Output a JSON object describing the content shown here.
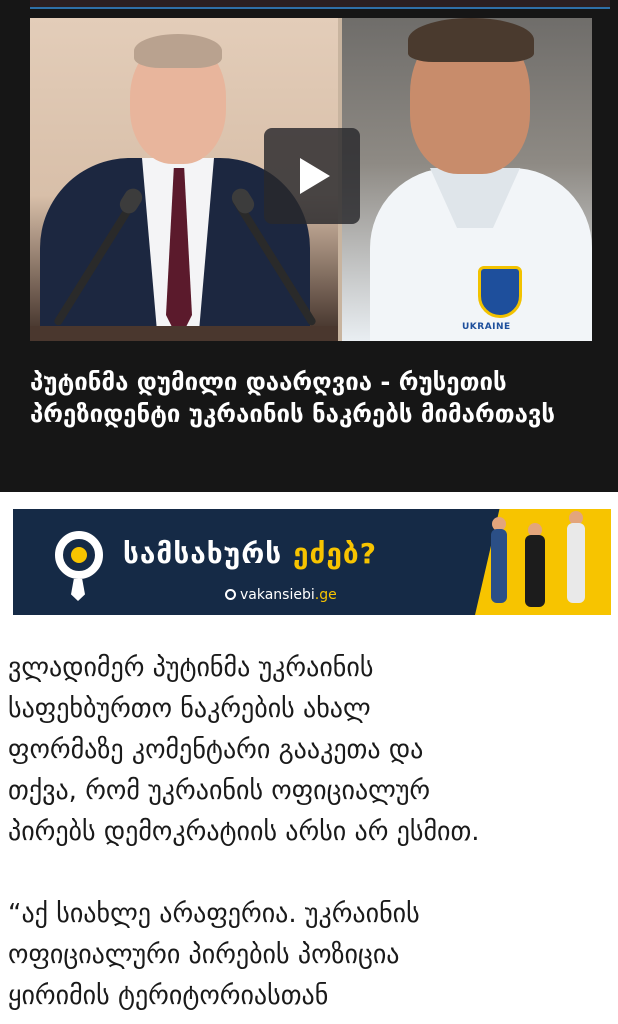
{
  "video": {
    "title": "პუტინმა დუმილი დაარღვია - რუსეთის პრეზიდენტი უკრაინის ნაკრებს მიმართავს",
    "jersey_text": "UKRAINE",
    "play_icon": "play-icon"
  },
  "banner": {
    "headline_main": "სამსახურს ",
    "headline_accent": "ეძებ?",
    "brand": "vakansiebi",
    "brand_tld": ".ge",
    "logo_icon": "magnifier-tie-icon",
    "accent_color": "#f7c400",
    "background_color": "#152a46"
  },
  "article": {
    "paragraph_1": "ვლადიმერ პუტინმა უკრაინის\nსაფეხბურთო ნაკრების ახალ\nფორმაზე კომენტარი გააკეთა და\nთქვა, რომ უკრაინის ოფიციალურ\nპირებს დემოკრატიის არსი არ ესმით.",
    "paragraph_2": "“აქ სიახლე არაფერია. უკრაინის\nოფიციალური პირების პოზიცია\nყირიმის ტერიტორიასთან"
  }
}
